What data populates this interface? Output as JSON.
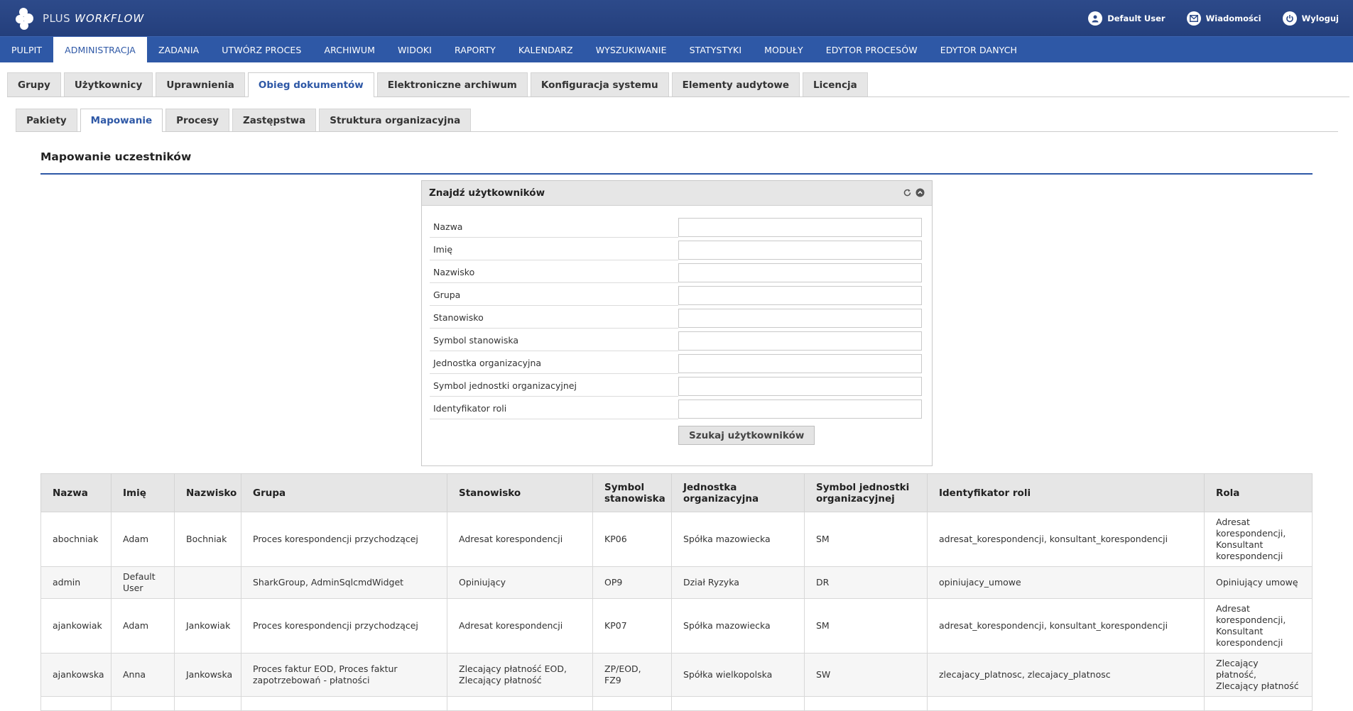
{
  "app": {
    "logo_plus": "PLUS",
    "logo_workflow": "WORKFLOW"
  },
  "header": {
    "user": "Default User",
    "messages": "Wiadomości",
    "logout": "Wyloguj"
  },
  "mainnav": [
    "PULPIT",
    "ADMINISTRACJA",
    "ZADANIA",
    "UTWÓRZ PROCES",
    "ARCHIWUM",
    "WIDOKI",
    "RAPORTY",
    "KALENDARZ",
    "WYSZUKIWANIE",
    "STATYSTYKI",
    "MODUŁY",
    "EDYTOR PROCESÓW",
    "EDYTOR DANYCH"
  ],
  "mainnav_active": "ADMINISTRACJA",
  "tabs1": [
    "Grupy",
    "Użytkownicy",
    "Uprawnienia",
    "Obieg dokumentów",
    "Elektroniczne archiwum",
    "Konfiguracja systemu",
    "Elementy audytowe",
    "Licencja"
  ],
  "tabs1_active": "Obieg dokumentów",
  "tabs2": [
    "Pakiety",
    "Mapowanie",
    "Procesy",
    "Zastępstwa",
    "Struktura organizacyjna"
  ],
  "tabs2_active": "Mapowanie",
  "section_title": "Mapowanie uczestników",
  "search_panel": {
    "title": "Znajdź użytkowników",
    "fields": [
      {
        "label": "Nazwa",
        "value": ""
      },
      {
        "label": "Imię",
        "value": ""
      },
      {
        "label": "Nazwisko",
        "value": ""
      },
      {
        "label": "Grupa",
        "value": ""
      },
      {
        "label": "Stanowisko",
        "value": ""
      },
      {
        "label": "Symbol stanowiska",
        "value": ""
      },
      {
        "label": "Jednostka organizacyjna",
        "value": ""
      },
      {
        "label": "Symbol jednostki organizacyjnej",
        "value": ""
      },
      {
        "label": "Identyfikator roli",
        "value": ""
      }
    ],
    "button": "Szukaj użytkowników"
  },
  "table": {
    "columns": [
      "Nazwa",
      "Imię",
      "Nazwisko",
      "Grupa",
      "Stanowisko",
      "Symbol stanowiska",
      "Jednostka organizacyjna",
      "Symbol jednostki organizacyjnej",
      "Identyfikator roli",
      "Rola"
    ],
    "rows": [
      [
        "abochniak",
        "Adam",
        "Bochniak",
        "Proces korespondencji przychodzącej",
        "Adresat korespondencji",
        "KP06",
        "Spółka mazowiecka",
        "SM",
        "adresat_korespondencji, konsultant_korespondencji",
        "Adresat korespondencji, Konsultant korespondencji"
      ],
      [
        "admin",
        "Default User",
        "",
        "SharkGroup, AdminSqlcmdWidget",
        "Opiniujący",
        "OP9",
        "Dział Ryzyka",
        "DR",
        "opiniujacy_umowe",
        "Opiniujący umowę"
      ],
      [
        "ajankowiak",
        "Adam",
        "Jankowiak",
        "Proces korespondencji przychodzącej",
        "Adresat korespondencji",
        "KP07",
        "Spółka mazowiecka",
        "SM",
        "adresat_korespondencji, konsultant_korespondencji",
        "Adresat korespondencji, Konsultant korespondencji"
      ],
      [
        "ajankowska",
        "Anna",
        "Jankowska",
        "Proces faktur EOD, Proces faktur zapotrzebowań - płatności",
        "Zlecający płatność EOD, Zlecający płatność",
        "ZP/EOD, FZ9",
        "Spółka wielkopolska",
        "SW",
        "zlecajacy_platnosc, zlecajacy_platnosc",
        "Zlecający płatność, Zlecający płatność"
      ]
    ]
  },
  "colors": {
    "header_bg": "#2d4a8a",
    "nav_bg": "#2e58a6",
    "accent": "#2e58a6"
  }
}
